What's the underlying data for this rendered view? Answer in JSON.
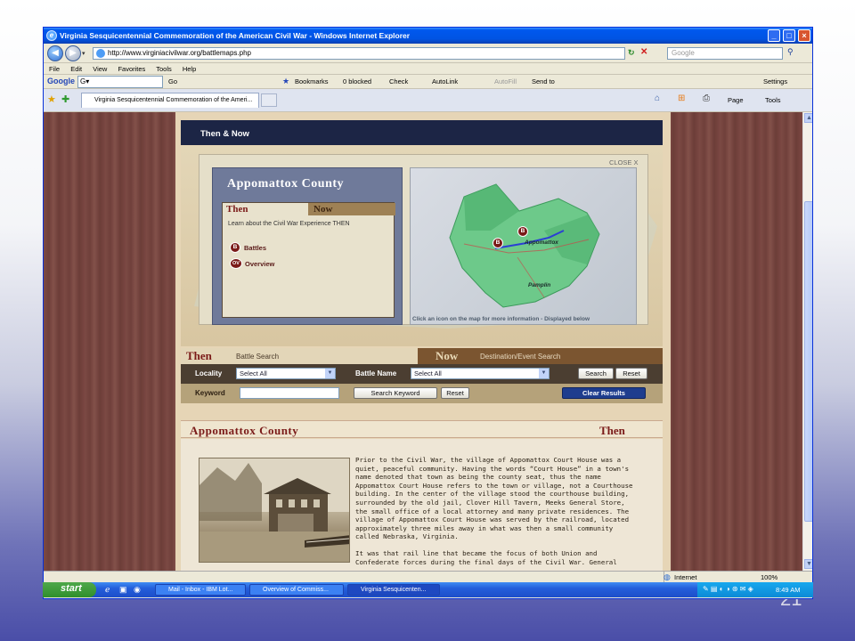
{
  "slide_number": "21",
  "browser": {
    "title": "Virginia Sesquicentennial Commemoration of the American Civil War - Windows Internet Explorer",
    "address": "http://www.virginiacivilwar.org/battlemaps.php",
    "search_placeholder": "Google",
    "menu": [
      "File",
      "Edit",
      "View",
      "Favorites",
      "Tools",
      "Help"
    ],
    "toolbar": {
      "google_label": "Google",
      "go": "Go",
      "bookmarks": "Bookmarks",
      "blocked": "0 blocked",
      "check": "Check",
      "autolink": "AutoLink",
      "autofill": "AutoFill",
      "send_to": "Send to",
      "settings": "Settings"
    },
    "tab_label": "Virginia Sesquicentennial Commemoration of the Ameri...",
    "cmd": {
      "page": "Page",
      "tools": "Tools"
    },
    "status": {
      "zone": "Internet",
      "zoom": "100%"
    }
  },
  "site": {
    "header": "Then & Now",
    "popup": {
      "close": "CLOSE X",
      "county_title": "Appomattox County",
      "tab_then": "Then",
      "tab_now": "Now",
      "learn": "Learn about the Civil War Experience THEN",
      "legend": [
        {
          "badge": "B",
          "label": "Battles"
        },
        {
          "badge": "OV",
          "label": "Overview"
        }
      ],
      "map_towns": {
        "appomattox": "Appomattox",
        "pamplin": "Pamplin"
      },
      "map_markers": [
        "B",
        "B"
      ],
      "map_caption": "Click an icon on the map for more information - Displayed below"
    },
    "search": {
      "then_tab": "Then",
      "then_sub": "Battle Search",
      "now_tab": "Now",
      "now_sub": "Destination/Event Search",
      "locality_label": "Locality",
      "locality_value": "Select All",
      "battle_label": "Battle Name",
      "battle_value": "Select All",
      "search_btn": "Search",
      "reset_btn": "Reset",
      "keyword_label": "Keyword",
      "keyword_value": "",
      "search_keyword_btn": "Search Keyword",
      "reset2_btn": "Reset",
      "clear_btn": "Clear Results"
    },
    "article": {
      "county": "Appomattox County",
      "era": "Then",
      "para1": "Prior to the Civil War, the village of Appomattox Court House was a quiet, peaceful community. Having the words “Court House” in a town's name denoted that town as being the county seat, thus the name Appomattox Court House refers to the town or village, not a Courthouse building. In the center of the village stood the courthouse building, surrounded by the old jail, Clover Hill Tavern, Meeks General Store, the small office of a local attorney and many private residences. The village of Appomattox Court House was served by the railroad, located approximately three miles away in what was then a small community called Nebraska, Virginia.",
      "para2": "It was that rail line that became the focus of both Union and Confederate forces during the final days of the Civil War. General"
    }
  },
  "taskbar": {
    "start": "start",
    "tasks": [
      "Mail - Inbox - IBM Lot...",
      "Overview of Commiss...",
      "Virginia Sesquicenten..."
    ],
    "clock": "8:49 AM"
  }
}
